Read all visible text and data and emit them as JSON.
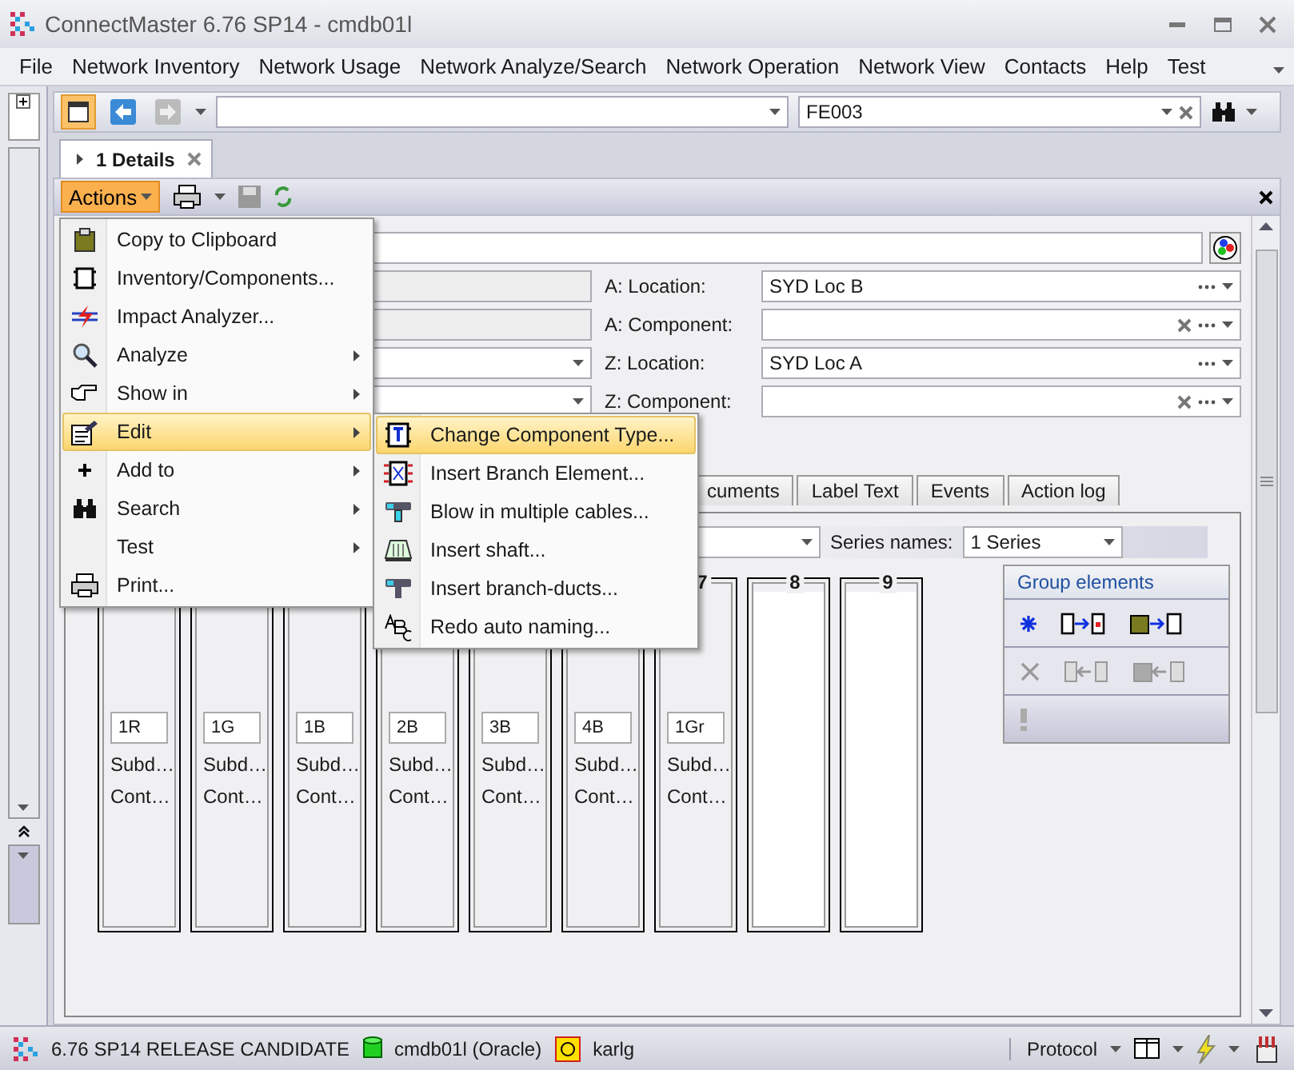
{
  "window": {
    "title": "ConnectMaster 6.76 SP14 - cmdb01l"
  },
  "menu_bar": [
    "File",
    "Network Inventory",
    "Network Usage",
    "Network Analyze/Search",
    "Network Operation",
    "Network View",
    "Contacts",
    "Help",
    "Test"
  ],
  "toolbar": {
    "search_value": "FE003"
  },
  "document_tabs": [
    {
      "label": "1 Details",
      "selected": true
    }
  ],
  "actions_button": "Actions",
  "left_fields": [
    {
      "kind": "readonly"
    },
    {
      "kind": "readonly"
    },
    {
      "kind": "dropdown"
    },
    {
      "kind": "dropdown"
    }
  ],
  "right_fields": [
    {
      "label": "A: Location:",
      "value": "SYD Loc B",
      "clear_button": false
    },
    {
      "label": "A: Component:",
      "clear_button": true
    },
    {
      "label": "Z: Location:",
      "value": "SYD Loc A",
      "clear_button": false
    },
    {
      "label": "Z: Component:",
      "clear_button": true
    }
  ],
  "detail_tabs": [
    "cuments",
    "Label Text",
    "Events",
    "Action log"
  ],
  "series": {
    "label": "Series names:",
    "value": "1 Series"
  },
  "columns": [
    {
      "code": "1R",
      "line_1": "Subd…",
      "line_2": "Cont…"
    },
    {
      "code": "1G",
      "line_1": "Subd…",
      "line_2": "Cont…"
    },
    {
      "code": "1B",
      "line_1": "Subd…",
      "line_2": "Cont…"
    },
    {
      "code": "2B",
      "line_1": "Subd…",
      "line_2": "Cont…"
    },
    {
      "code": "3B",
      "line_1": "Subd…",
      "line_2": "Cont…"
    },
    {
      "code": "4B",
      "line_1": "Subd…",
      "line_2": "Cont…"
    },
    {
      "header": "7",
      "code": "1Gr",
      "line_1": "Subd…",
      "line_2": "Cont…"
    },
    {
      "header": "8"
    },
    {
      "header": "9"
    }
  ],
  "group_elements": {
    "title": "Group elements"
  },
  "actions_menu": [
    {
      "label": "Copy to Clipboard",
      "has_submenu": false,
      "selected": false
    },
    {
      "label": "Inventory/Components...",
      "has_submenu": false,
      "selected": false
    },
    {
      "label": "Impact Analyzer...",
      "has_submenu": false,
      "selected": false
    },
    {
      "label": "Analyze",
      "has_submenu": true,
      "selected": false
    },
    {
      "label": "Show in",
      "has_submenu": true,
      "selected": false
    },
    {
      "label": "Edit",
      "has_submenu": true,
      "selected": true
    },
    {
      "label": "Add to",
      "has_submenu": true,
      "selected": false
    },
    {
      "label": "Search",
      "has_submenu": true,
      "selected": false
    },
    {
      "label": "Test",
      "has_submenu": true,
      "selected": false
    },
    {
      "label": "Print...",
      "has_submenu": false,
      "selected": false
    }
  ],
  "edit_submenu": [
    {
      "label": "Change Component Type...",
      "selected": true
    },
    {
      "label": "Insert Branch Element...",
      "selected": false
    },
    {
      "label": "Blow in multiple cables...",
      "selected": false
    },
    {
      "label": "Insert shaft...",
      "selected": false
    },
    {
      "label": "Insert branch-ducts...",
      "selected": false
    },
    {
      "label": "Redo auto naming...",
      "selected": false
    }
  ],
  "status_bar": {
    "version": "6.76 SP14 RELEASE CANDIDATE",
    "database": "cmdb01l (Oracle)",
    "user": "karlg",
    "protocol": "Protocol"
  }
}
